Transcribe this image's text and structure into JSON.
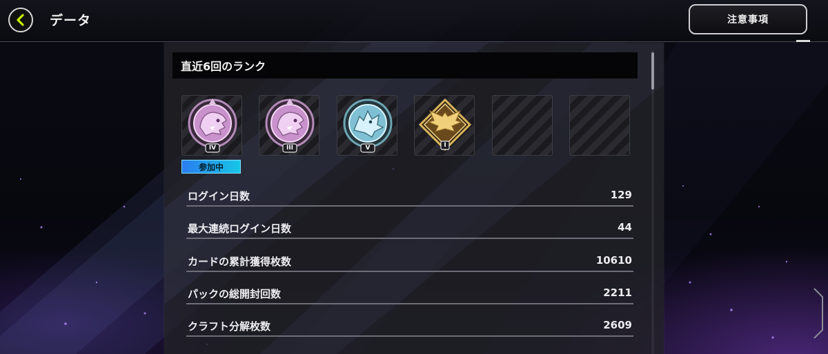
{
  "header": {
    "title": "データ",
    "notice_button": "注意事項"
  },
  "rank_section": {
    "title": "直近6回のランク",
    "participating_label": "参加中",
    "ranks": [
      {
        "emblem": "pink-beast-emblem",
        "tier": "IV",
        "color": "#d79ad8",
        "current": true
      },
      {
        "emblem": "pink-beast-emblem",
        "tier": "III",
        "color": "#d79ad8",
        "current": false
      },
      {
        "emblem": "wolf-emblem",
        "tier": "V",
        "color": "#8fd0e4",
        "current": false
      },
      {
        "emblem": "gold-eagle-emblem",
        "tier": "I",
        "color": "#d9b45a",
        "current": false
      },
      {
        "emblem": "empty",
        "tier": "",
        "color": "",
        "current": false
      },
      {
        "emblem": "empty",
        "tier": "",
        "color": "",
        "current": false
      }
    ]
  },
  "stats": [
    {
      "label": "ログイン日数",
      "value": "129"
    },
    {
      "label": "最大連続ログイン日数",
      "value": "44"
    },
    {
      "label": "カードの累計獲得枚数",
      "value": "10610"
    },
    {
      "label": "パックの総開封回数",
      "value": "2211"
    },
    {
      "label": "クラフト分解枚数",
      "value": "2609"
    }
  ],
  "colors": {
    "accent_back": "#c6f000",
    "participating_badge": "#1aa8ee"
  }
}
